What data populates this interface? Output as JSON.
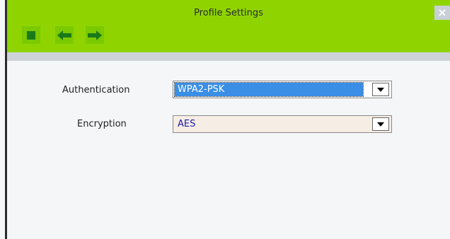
{
  "window": {
    "title": "Profile Settings",
    "close_label": "×"
  },
  "toolbar": {
    "buttons": [
      {
        "icon": "stop-icon"
      },
      {
        "icon": "arrow-left-icon"
      },
      {
        "icon": "arrow-right-icon"
      }
    ]
  },
  "form": {
    "authentication": {
      "label": "Authentication",
      "value": "WPA2-PSK"
    },
    "encryption": {
      "label": "Encryption",
      "value": "AES"
    }
  },
  "colors": {
    "header_green": "#8fd400",
    "button_green": "#7bc900",
    "icon_green": "#1a7a1a",
    "selection_blue": "#3a8ee6",
    "encryption_value_blue": "#1b1bb0"
  }
}
